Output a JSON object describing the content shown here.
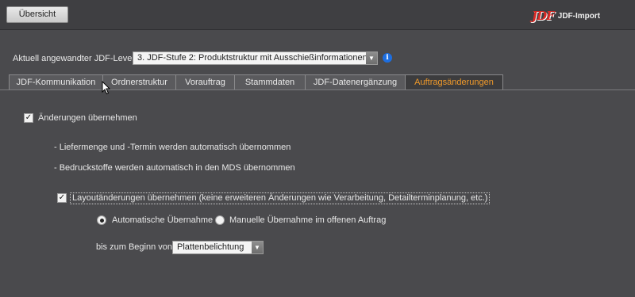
{
  "header": {
    "overview_button": "Übersicht",
    "logo_mark": "JDF",
    "logo_text": "JDF-Import"
  },
  "level": {
    "label": "Aktuell angewandter JDF-Level:",
    "value": "3. JDF-Stufe 2: Produktstruktur mit Ausschießinformationen",
    "info_icon": "info-icon"
  },
  "tabs": [
    {
      "label": "JDF-Kommunikation",
      "active": false
    },
    {
      "label": "Ordnerstruktur",
      "active": false
    },
    {
      "label": "Vorauftrag",
      "active": false
    },
    {
      "label": "Stammdaten",
      "active": false
    },
    {
      "label": "JDF-Datenergänzung",
      "active": false
    },
    {
      "label": "Auftragsänderungen",
      "active": true
    }
  ],
  "content": {
    "apply_changes": {
      "label": "Änderungen übernehmen",
      "checked": true
    },
    "note1": "-  Liefermenge und -Termin werden automatisch übernommen",
    "note2": "-  Bedruckstoffe werden automatisch in den MDS übernommen",
    "layout_changes": {
      "label": "Layoutänderungen übernehmen (keine erweiteren Änderungen wie Verarbeitung, Detailterminplanung, etc.)",
      "checked": true
    },
    "radio_auto": {
      "label": "Automatische Übernahme",
      "selected": true
    },
    "radio_manual": {
      "label": "Manuelle Übernahme im offenen Auftrag",
      "selected": false
    },
    "until_label": "bis zum Beginn von",
    "until_value": "Plattenbelichtung"
  },
  "colors": {
    "background": "#4a4a4d",
    "active_tab_text": "#f19a2a",
    "logo_red": "#d92a25",
    "info_blue": "#1d6ee0"
  }
}
